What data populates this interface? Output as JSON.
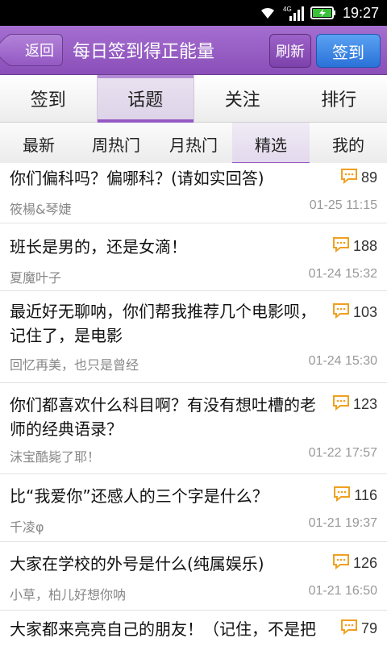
{
  "status": {
    "time": "19:27",
    "network": "4G"
  },
  "header": {
    "back_label": "返回",
    "title": "每日签到得正能量",
    "refresh_label": "刷新",
    "signin_label": "签到"
  },
  "tabs": [
    {
      "label": "签到"
    },
    {
      "label": "话题"
    },
    {
      "label": "关注"
    },
    {
      "label": "排行"
    }
  ],
  "subtabs": [
    {
      "label": "最新"
    },
    {
      "label": "周热门"
    },
    {
      "label": "月热门"
    },
    {
      "label": "精选"
    },
    {
      "label": "我的"
    }
  ],
  "colors": {
    "accent": "#9459c3",
    "primary_button": "#2b72d8",
    "comment_icon": "#f0a020"
  },
  "topics": [
    {
      "title": "你们偏科吗？偏哪科？(请如实回答)",
      "author": "筱楊&琴婕",
      "date": "01-25 11:15",
      "comments": "89"
    },
    {
      "title": "班长是男的，还是女滴！",
      "author": "夏魔叶子",
      "date": "01-24 15:32",
      "comments": "188"
    },
    {
      "title": "最近好无聊呐，你们帮我推荐几个电影呗，记住了，是电影",
      "author": "回忆再美，也只是曾经",
      "date": "01-24 15:30",
      "comments": "103"
    },
    {
      "title": "你们都喜欢什么科目啊？有没有想吐槽的老师的经典语录？",
      "author": "沫宝酷毙了耶！",
      "date": "01-22 17:57",
      "comments": "123"
    },
    {
      "title": "比“我爱你”还感人的三个字是什么？",
      "author": "千凌φ",
      "date": "01-21 19:37",
      "comments": "116"
    },
    {
      "title": "大家在学校的外号是什么(纯属娱乐)",
      "author": "小草，柏儿好想你呐",
      "date": "01-21 16:50",
      "comments": "126"
    },
    {
      "title": "大家都来亮亮自己的朋友！（记住，不是把",
      "author": "",
      "date": "",
      "comments": "79"
    }
  ]
}
